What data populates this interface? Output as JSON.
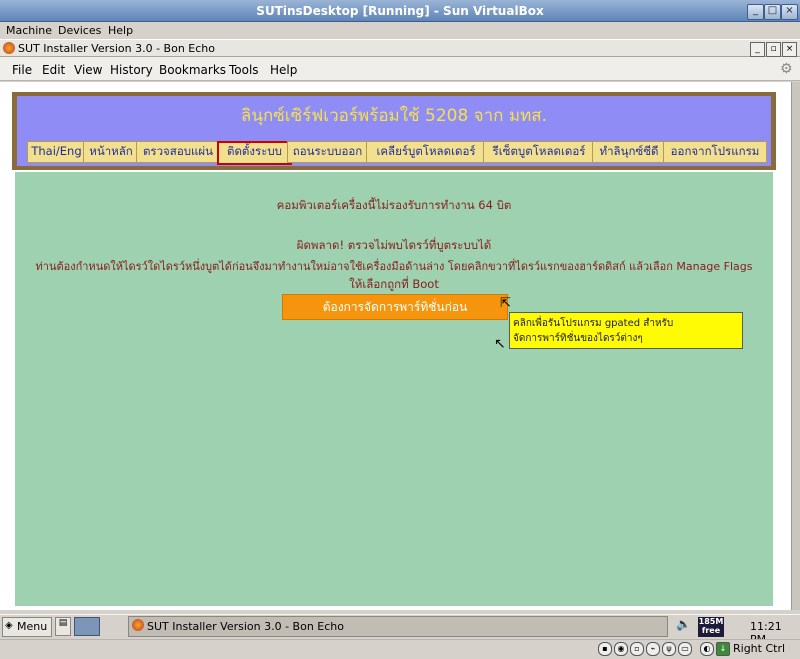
{
  "vbox": {
    "title": "SUTinsDesktop [Running] - Sun VirtualBox",
    "menu": [
      "Machine",
      "Devices",
      "Help"
    ]
  },
  "browser": {
    "title": "SUT Installer Version 3.0 - Bon Echo",
    "menu": [
      "File",
      "Edit",
      "View",
      "History",
      "Bookmarks",
      "Tools",
      "Help"
    ]
  },
  "page": {
    "banner_title": "ลินุกซ์เซิร์ฟเวอร์พร้อมใช้ 5208 จาก มทส.",
    "nav": [
      "Thai/Eng",
      "หน้าหลัก",
      "ตรวจสอบแผ่น",
      "ติดตั้งระบบ",
      "ถอนระบบออก",
      "เคลียร์บูตโหลดเดอร์",
      "รีเซ็ตบูตโหลดเดอร์",
      "ทำลินุกซ์ซีดี",
      "ออกจากโปรแกรม"
    ],
    "messages": {
      "line1": "คอมพิวเตอร์เครื่องนี้ไม่รองรับการทำงาน 64 บิต",
      "line2": "ผิดพลาด! ตรวจไม่พบไดรว์ที่บูตระบบได้",
      "line3": "ท่านต้องกำหนดให้ไดรว์ใดไดรว์หนึ่งบูตได้ก่อนจึงมาทำงานใหม่อาจใช้เครื่องมือด้านล่าง โดยคลิกขวาที่ไดรว์แรกของฮาร์ดดิสก์ แล้วเลือก Manage Flags",
      "line4": "ให้เลือกถูกที่ Boot"
    },
    "action_button": "ต้องการจัดการพาร์ทิชั่นก่อน",
    "tooltip": {
      "line1": "คลิกเพื่อรันโปรแกรม gpated สำหรับ",
      "line2": "จัดการพาร์ทิชั่นของไดรว์ต่างๆ"
    }
  },
  "taskbar": {
    "start": "Menu",
    "task": "SUT Installer Version 3.0 - Bon Echo",
    "mem_top": "185M",
    "mem_bottom": "free",
    "clock": "11:21 PM",
    "host_key": "Right Ctrl"
  }
}
